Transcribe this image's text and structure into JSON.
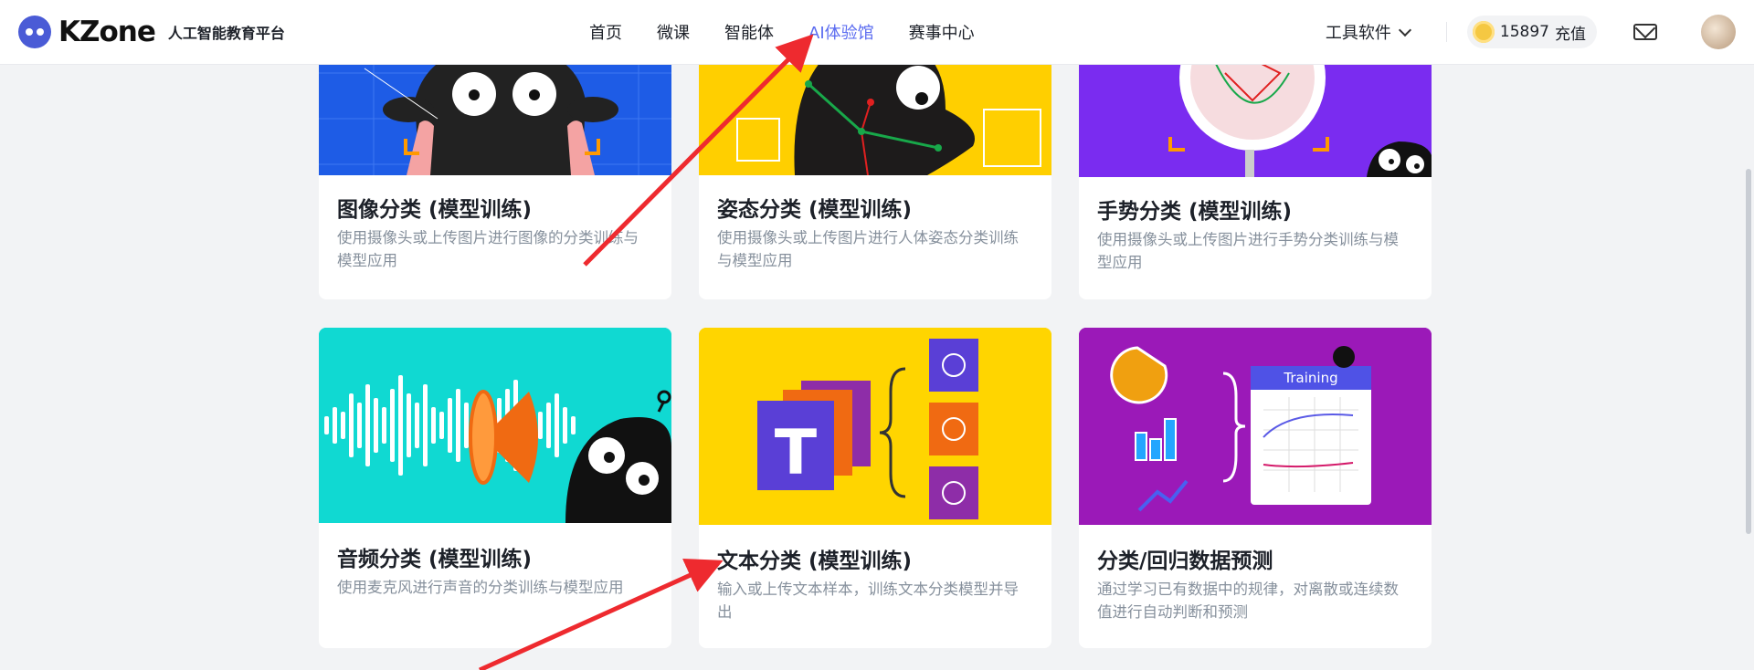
{
  "header": {
    "brand": "KZone",
    "subtitle": "人工智能教育平台",
    "nav": [
      "首页",
      "微课",
      "智能体",
      "AI体验馆",
      "赛事中心"
    ],
    "active_nav": "AI体验馆",
    "tools_label": "工具软件",
    "coins": "15897",
    "recharge_label": "充值"
  },
  "cards": [
    {
      "title": "图像分类 (模型训练)",
      "desc": "使用摄像头或上传图片进行图像的分类训练与模型应用",
      "theme": "#1e5ce6"
    },
    {
      "title": "姿态分类 (模型训练)",
      "desc": "使用摄像头或上传图片进行人体姿态分类训练与模型应用",
      "theme": "#ffcf00"
    },
    {
      "title": "手势分类 (模型训练)",
      "desc": "使用摄像头或上传图片进行手势分类训练与模型应用",
      "theme": "#7a2cf0"
    },
    {
      "title": "音频分类 (模型训练)",
      "desc": "使用麦克风进行声音的分类训练与模型应用",
      "theme": "#10d9d2"
    },
    {
      "title": "文本分类 (模型训练)",
      "desc": "输入或上传文本样本，训练文本分类模型并导出",
      "theme": "#ffd500"
    },
    {
      "title": "分类/回归数据预测",
      "desc": "通过学习已有数据中的规律，对离散或连续数值进行自动判断和预测",
      "theme": "#9b19b8",
      "thumb_label": "Training"
    }
  ],
  "colors": {
    "accent": "#5b6cf0",
    "arrow": "#ee2a2f"
  }
}
